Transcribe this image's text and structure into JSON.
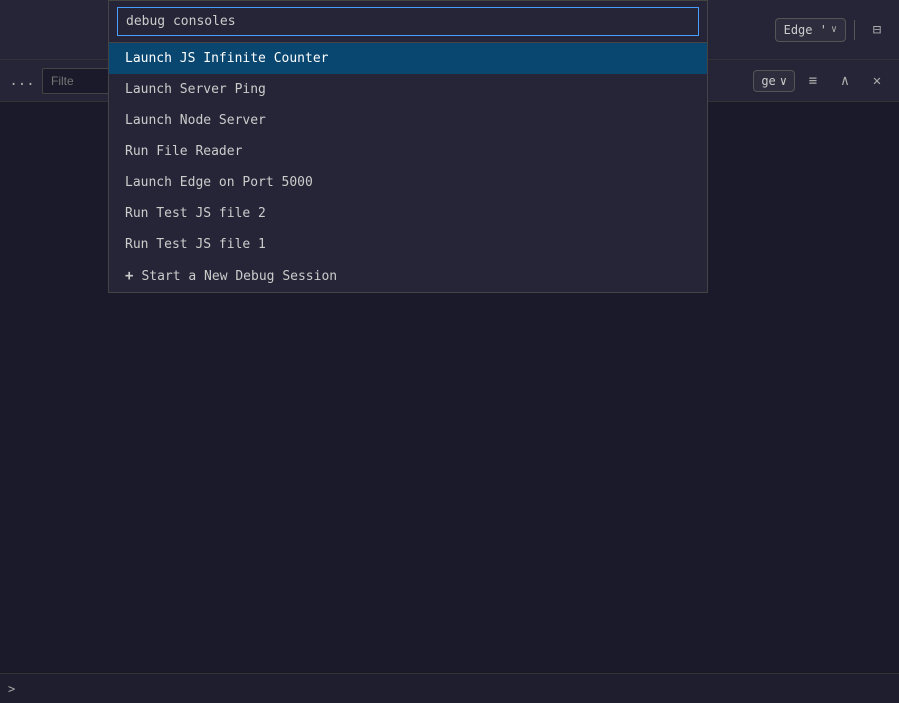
{
  "topbar": {
    "edge_label": "Edge '",
    "chevron": "∨"
  },
  "secondbar": {
    "ellipsis": "...",
    "filter_placeholder": "Filte",
    "edge_label": "ge",
    "chevron": "∨"
  },
  "command_palette": {
    "input_value": "debug consoles ",
    "items": [
      {
        "id": 1,
        "label": "Launch JS Infinite Counter",
        "icon": null
      },
      {
        "id": 2,
        "label": "Launch Server Ping",
        "icon": null
      },
      {
        "id": 3,
        "label": "Launch Node Server",
        "icon": null
      },
      {
        "id": 4,
        "label": "Run File Reader",
        "icon": null
      },
      {
        "id": 5,
        "label": "Launch Edge on Port 5000",
        "icon": null
      },
      {
        "id": 6,
        "label": "Run Test JS file 2",
        "icon": null
      },
      {
        "id": 7,
        "label": "Run Test JS file 1",
        "icon": null
      },
      {
        "id": 8,
        "label": "Start a New Debug Session",
        "icon": "+"
      }
    ]
  },
  "bottombar": {
    "chevron": ">"
  },
  "toolbar_icons": {
    "layout": "⊟",
    "up": "∧",
    "close": "✕",
    "menu": "≡"
  }
}
